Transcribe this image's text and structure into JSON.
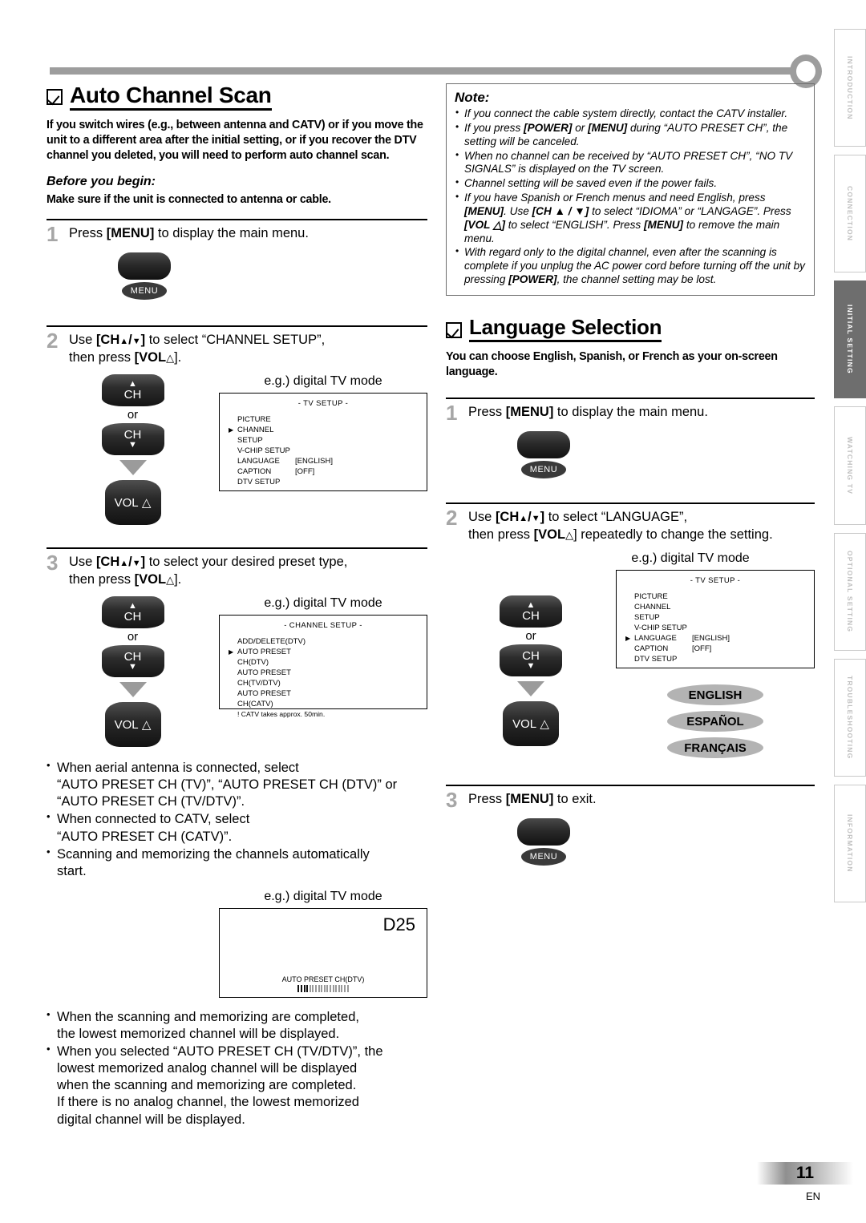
{
  "sidetabs": [
    {
      "label": "INTRODUCTION",
      "active": false
    },
    {
      "label": "CONNECTION",
      "active": false
    },
    {
      "label": "INITIAL  SETTING",
      "active": true
    },
    {
      "label": "WATCHING  TV",
      "active": false
    },
    {
      "label": "OPTIONAL  SETTING",
      "active": false
    },
    {
      "label": "TROUBLESHOOTING",
      "active": false
    },
    {
      "label": "INFORMATION",
      "active": false
    }
  ],
  "left": {
    "title": "Auto Channel Scan",
    "intro": "If you switch wires (e.g., between antenna and CATV) or if you move the unit to a different area after the initial setting, or if you recover the DTV channel you deleted, you will need to perform auto channel scan.",
    "before_heading": "Before you begin:",
    "before_text": "Make sure if the unit is connected to antenna or cable.",
    "step1": {
      "num": "1",
      "text_a": "Press ",
      "text_b": "[MENU]",
      "text_c": " to display the main menu.",
      "menu_label": "MENU"
    },
    "step2": {
      "num": "2",
      "line1_a": "Use ",
      "line1_b": "[CH",
      "line1_c": "/",
      "line1_d": "]",
      "line1_e": " to select “CHANNEL SETUP”,",
      "line2_a": "then press ",
      "line2_b": "[VOL",
      "line2_c": "].",
      "ch_label": "CH",
      "or_label": "or",
      "vol_label": "VOL",
      "eg_label": "e.g.) digital TV mode",
      "osd": {
        "title": "-  TV SETUP  -",
        "rows": [
          {
            "name": "PICTURE",
            "value": "",
            "cursor": false
          },
          {
            "name": "CHANNEL SETUP",
            "value": "",
            "cursor": true
          },
          {
            "name": "V-CHIP  SETUP",
            "value": "",
            "cursor": false
          },
          {
            "name": "LANGUAGE",
            "value": "[ENGLISH]",
            "cursor": false
          },
          {
            "name": "CAPTION",
            "value": "[OFF]",
            "cursor": false
          },
          {
            "name": "DTV SETUP",
            "value": "",
            "cursor": false
          }
        ]
      }
    },
    "step3": {
      "num": "3",
      "line1_a": "Use ",
      "line1_b": "[CH",
      "line1_c": "/",
      "line1_d": "]",
      "line1_e": " to select your desired preset type,",
      "line2_a": "then press ",
      "line2_b": "[VOL",
      "line2_c": "].",
      "ch_label": "CH",
      "or_label": "or",
      "vol_label": "VOL",
      "eg_label": "e.g.) digital TV mode",
      "osd": {
        "title": "- CHANNEL SETUP -",
        "rows": [
          {
            "name": "ADD/DELETE(DTV)",
            "cursor": false
          },
          {
            "name": "AUTO PRESET CH(DTV)",
            "cursor": true
          },
          {
            "name": "AUTO PRESET CH(TV/DTV)",
            "cursor": false
          },
          {
            "name": "AUTO PRESET CH(CATV)",
            "cursor": false
          }
        ],
        "note": "! CATV takes approx. 50min."
      }
    },
    "bullets_a": [
      {
        "l1": "When aerial antenna is connected, select",
        "l2": "“AUTO PRESET CH (TV)”, “AUTO PRESET CH (DTV)” or",
        "l3": "“AUTO PRESET CH (TV/DTV)”."
      },
      {
        "l1": "When connected to CATV, select",
        "l2": "“AUTO PRESET CH (CATV)”.",
        "l3": ""
      },
      {
        "l1": "Scanning and memorizing the channels automatically",
        "l2": "start.",
        "l3": ""
      }
    ],
    "scan": {
      "eg_label": "e.g.) digital TV mode",
      "channel": "D25",
      "status": "AUTO PRESET CH(DTV)",
      "progress_total": 18,
      "progress_filled": 4
    },
    "bullets_b": [
      {
        "l1": "When the scanning and memorizing are completed,",
        "l2": "the lowest memorized channel will be displayed.",
        "l3": "",
        "l4": "",
        "l5": ""
      },
      {
        "l1": "When you selected “AUTO PRESET CH (TV/DTV)”, the",
        "l2": "lowest memorized analog channel will be displayed",
        "l3": "when the scanning and memorizing are completed.",
        "l4": "If there is no analog channel, the lowest memorized",
        "l5": "digital channel will be displayed."
      }
    ]
  },
  "note": {
    "heading": "Note:",
    "items": [
      [
        {
          "t": "If you connect the cable system directly, contact the CATV installer.",
          "b": false
        }
      ],
      [
        {
          "t": "If you press ",
          "b": false
        },
        {
          "t": "[POWER]",
          "b": true
        },
        {
          "t": " or ",
          "b": false
        },
        {
          "t": "[MENU]",
          "b": true
        },
        {
          "t": " during “AUTO PRESET CH”, the setting will be canceled.",
          "b": false
        }
      ],
      [
        {
          "t": "When no channel can be received by “AUTO PRESET CH”, “NO TV SIGNALS” is displayed on the TV screen.",
          "b": false
        }
      ],
      [
        {
          "t": "Channel setting will be saved even if the power fails.",
          "b": false
        }
      ],
      [
        {
          "t": "If you have Spanish or French menus and need English, press ",
          "b": false
        },
        {
          "t": "[MENU]",
          "b": true
        },
        {
          "t": ". Use ",
          "b": false
        },
        {
          "t": "[CH ▲ / ▼]",
          "b": true
        },
        {
          "t": " to select “IDIOMA” or “LANGAGE”. Press ",
          "b": false
        },
        {
          "t": "[VOL △]",
          "b": true
        },
        {
          "t": " to select “ENGLISH”. Press ",
          "b": false
        },
        {
          "t": "[MENU]",
          "b": true
        },
        {
          "t": " to remove the main menu.",
          "b": false
        }
      ],
      [
        {
          "t": "With regard only to the digital channel, even after the scanning is complete if you unplug the AC power cord before turning off the unit by pressing ",
          "b": false
        },
        {
          "t": "[POWER]",
          "b": true
        },
        {
          "t": ", the channel setting may be lost.",
          "b": false
        }
      ]
    ]
  },
  "right": {
    "title": "Language Selection",
    "intro": "You can choose English, Spanish, or French as your on-screen language.",
    "step1": {
      "num": "1",
      "text_a": "Press ",
      "text_b": "[MENU]",
      "text_c": " to display the main menu.",
      "menu_label": "MENU"
    },
    "step2": {
      "num": "2",
      "line1_a": "Use ",
      "line1_b": "[CH",
      "line1_c": "/",
      "line1_d": "]",
      "line1_e": " to select “LANGUAGE”,",
      "line2_a": "then press ",
      "line2_b": "[VOL",
      "line2_c": "] repeatedly to change the setting.",
      "ch_label": "CH",
      "or_label": "or",
      "vol_label": "VOL",
      "eg_label": "e.g.) digital TV mode",
      "osd": {
        "title": "-  TV SETUP  -",
        "rows": [
          {
            "name": "PICTURE",
            "value": "",
            "cursor": false
          },
          {
            "name": "CHANNEL SETUP",
            "value": "",
            "cursor": false
          },
          {
            "name": "V-CHIP  SETUP",
            "value": "",
            "cursor": false
          },
          {
            "name": "LANGUAGE",
            "value": "[ENGLISH]",
            "cursor": true
          },
          {
            "name": "CAPTION",
            "value": "[OFF]",
            "cursor": false
          },
          {
            "name": "DTV SETUP",
            "value": "",
            "cursor": false
          }
        ]
      },
      "languages": [
        "ENGLISH",
        "ESPAÑOL",
        "FRANÇAIS"
      ]
    },
    "step3": {
      "num": "3",
      "text_a": "Press ",
      "text_b": "[MENU]",
      "text_c": " to exit.",
      "menu_label": "MENU"
    }
  },
  "footer": {
    "page": "11",
    "lang": "EN"
  }
}
